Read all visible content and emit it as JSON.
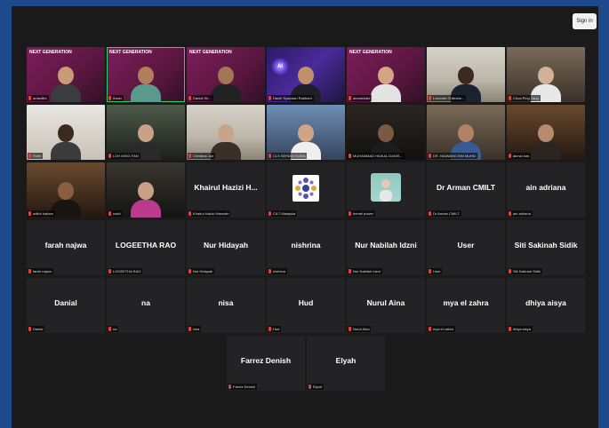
{
  "header": {
    "sign_in_label": "Sign in"
  },
  "brand_text": "NEXT GENERATION",
  "ai_badge": "AI",
  "video_tiles": [
    {
      "tag": "anawiller"
    },
    {
      "tag": "Ihsan"
    },
    {
      "tag": "Danial Sh..."
    },
    {
      "tag": "Haziri Syazwan Rabbani"
    },
    {
      "tag": "ainaashaid"
    },
    {
      "tag": "Lukonde Chileshe..."
    },
    {
      "tag": "Chua Ping Yang"
    },
    {
      "tag": "Rohit"
    },
    {
      "tag": "LOH MING FAN"
    },
    {
      "tag": "Christina Joe"
    },
    {
      "tag": "CLS SERIAN KUMA"
    },
    {
      "tag": "MUHAMMAD HAIKAL DANIS..."
    },
    {
      "tag": "DR. NAIWANG BIN MUHD"
    },
    {
      "tag": "akmal nas"
    },
    {
      "tag": "adibh hakam"
    },
    {
      "tag": "nabil"
    }
  ],
  "name_tiles": [
    {
      "name": "Khairul Hazizi H...",
      "tag": "Khairul Hazizi Hamzah"
    },
    {
      "name": "",
      "tag": "CILT Malaysia"
    },
    {
      "name": "",
      "tag": "hemel power"
    },
    {
      "name": "Dr Arman CMILT",
      "tag": "Dr Arman CMILT"
    },
    {
      "name": "ain adriana",
      "tag": "ain adriana"
    },
    {
      "name": "farah najwa",
      "tag": "farah najwa"
    },
    {
      "name": "LOGEETHA RAO",
      "tag": "LOGEETHA RAO"
    },
    {
      "name": "Nur Hidayah",
      "tag": "Nur Hidayah"
    },
    {
      "name": "nishrina",
      "tag": "nishrina"
    },
    {
      "name": "Nur Nabilah Idzni",
      "tag": "Nur Nabilah Idzni"
    },
    {
      "name": "User",
      "tag": "User"
    },
    {
      "name": "Siti Sakinah Sidik",
      "tag": "Siti Sakinah Sidik"
    },
    {
      "name": "Danial",
      "tag": "Danial"
    },
    {
      "name": "na",
      "tag": "na"
    },
    {
      "name": "nisa",
      "tag": "nisa"
    },
    {
      "name": "Hud",
      "tag": "Hud"
    },
    {
      "name": "Nurul Aina",
      "tag": "Nurul Aina"
    },
    {
      "name": "mya el zahra",
      "tag": "mya el zahra"
    },
    {
      "name": "dhiya aisya",
      "tag": "dhiya aisya"
    },
    {
      "name": "Farrez Denish",
      "tag": "Farrez Denish"
    },
    {
      "name": "Elyah",
      "tag": "Elyah"
    }
  ]
}
